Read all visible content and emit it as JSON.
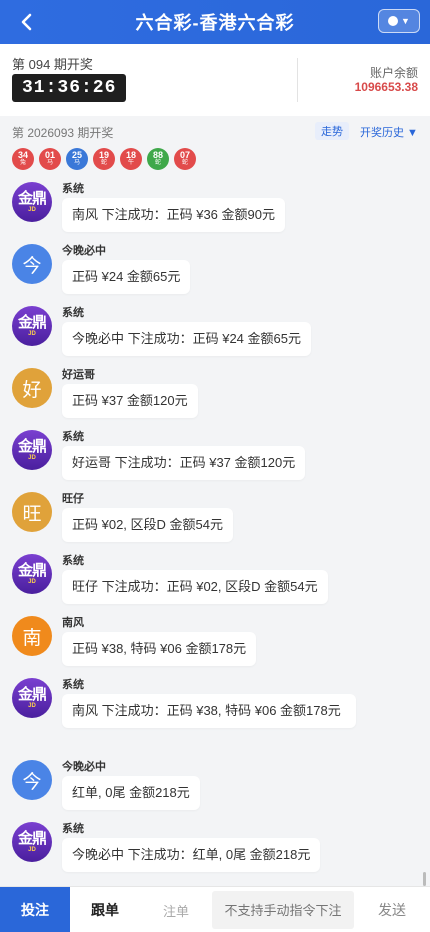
{
  "header": {
    "title": "六合彩-香港六合彩",
    "back_icon": "chevron-left-icon",
    "switch_icon": "lottery-switch-icon"
  },
  "current": {
    "period_label": "第 094 期开奖",
    "countdown": "31:36:26"
  },
  "account": {
    "balance_label": "账户余额",
    "balance_value": "1096653.38"
  },
  "last_draw": {
    "label": "第 2026093 期开奖",
    "trend_label": "走势",
    "history_label": "开奖历史 ▼",
    "balls": [
      {
        "num": "34",
        "zodiac": "兔",
        "color": "#e24b4b"
      },
      {
        "num": "01",
        "zodiac": "马",
        "color": "#e24b4b"
      },
      {
        "num": "25",
        "zodiac": "马",
        "color": "#3a78d8"
      },
      {
        "num": "19",
        "zodiac": "蛇",
        "color": "#e24b4b"
      },
      {
        "num": "18",
        "zodiac": "午",
        "color": "#e24b4b"
      },
      {
        "num": "88",
        "zodiac": "蛇",
        "color": "#3fa84a"
      },
      {
        "num": "07",
        "zodiac": "蛇",
        "color": "#e24b4b"
      }
    ]
  },
  "messages": [
    {
      "sender": "系统",
      "avatar": "logo",
      "text": "南风 下注成功：正码 ¥36 金额90元"
    },
    {
      "sender": "今晚必中",
      "avatar": "今",
      "avatar_color": "#4a84e6",
      "text": "正码 ¥24 金额65元"
    },
    {
      "sender": "系统",
      "avatar": "logo",
      "text": "今晚必中 下注成功：正码 ¥24 金额65元"
    },
    {
      "sender": "好运哥",
      "avatar": "好",
      "avatar_color": "#e0a23a",
      "text": "正码 ¥37 金额120元"
    },
    {
      "sender": "系统",
      "avatar": "logo",
      "text": "好运哥 下注成功：正码 ¥37 金额120元"
    },
    {
      "sender": "旺仔",
      "avatar": "旺",
      "avatar_color": "#e0a23a",
      "text": "正码 ¥02, 区段D 金额54元"
    },
    {
      "sender": "系统",
      "avatar": "logo",
      "text": "旺仔 下注成功：正码 ¥02, 区段D 金额54元"
    },
    {
      "sender": "南风",
      "avatar": "南",
      "avatar_color": "#f08a1c",
      "text": "正码 ¥38, 特码 ¥06 金额178元"
    },
    {
      "sender": "系统",
      "avatar": "logo",
      "text": "南风 下注成功：正码 ¥38, 特码 ¥06 金额178元"
    },
    {
      "sender": "今晚必中",
      "avatar": "今",
      "avatar_color": "#4a84e6",
      "text": "红单, 0尾 金额218元"
    },
    {
      "sender": "系统",
      "avatar": "logo",
      "text": "今晚必中 下注成功：红单, 0尾 金额218元"
    }
  ],
  "logo": {
    "big": "金鼎",
    "small": "JD"
  },
  "bottom": {
    "bet_label": "投注",
    "follow_label": "跟单",
    "note_label": "注单",
    "input_placeholder": "不支持手动指令下注",
    "send_label": "发送"
  }
}
